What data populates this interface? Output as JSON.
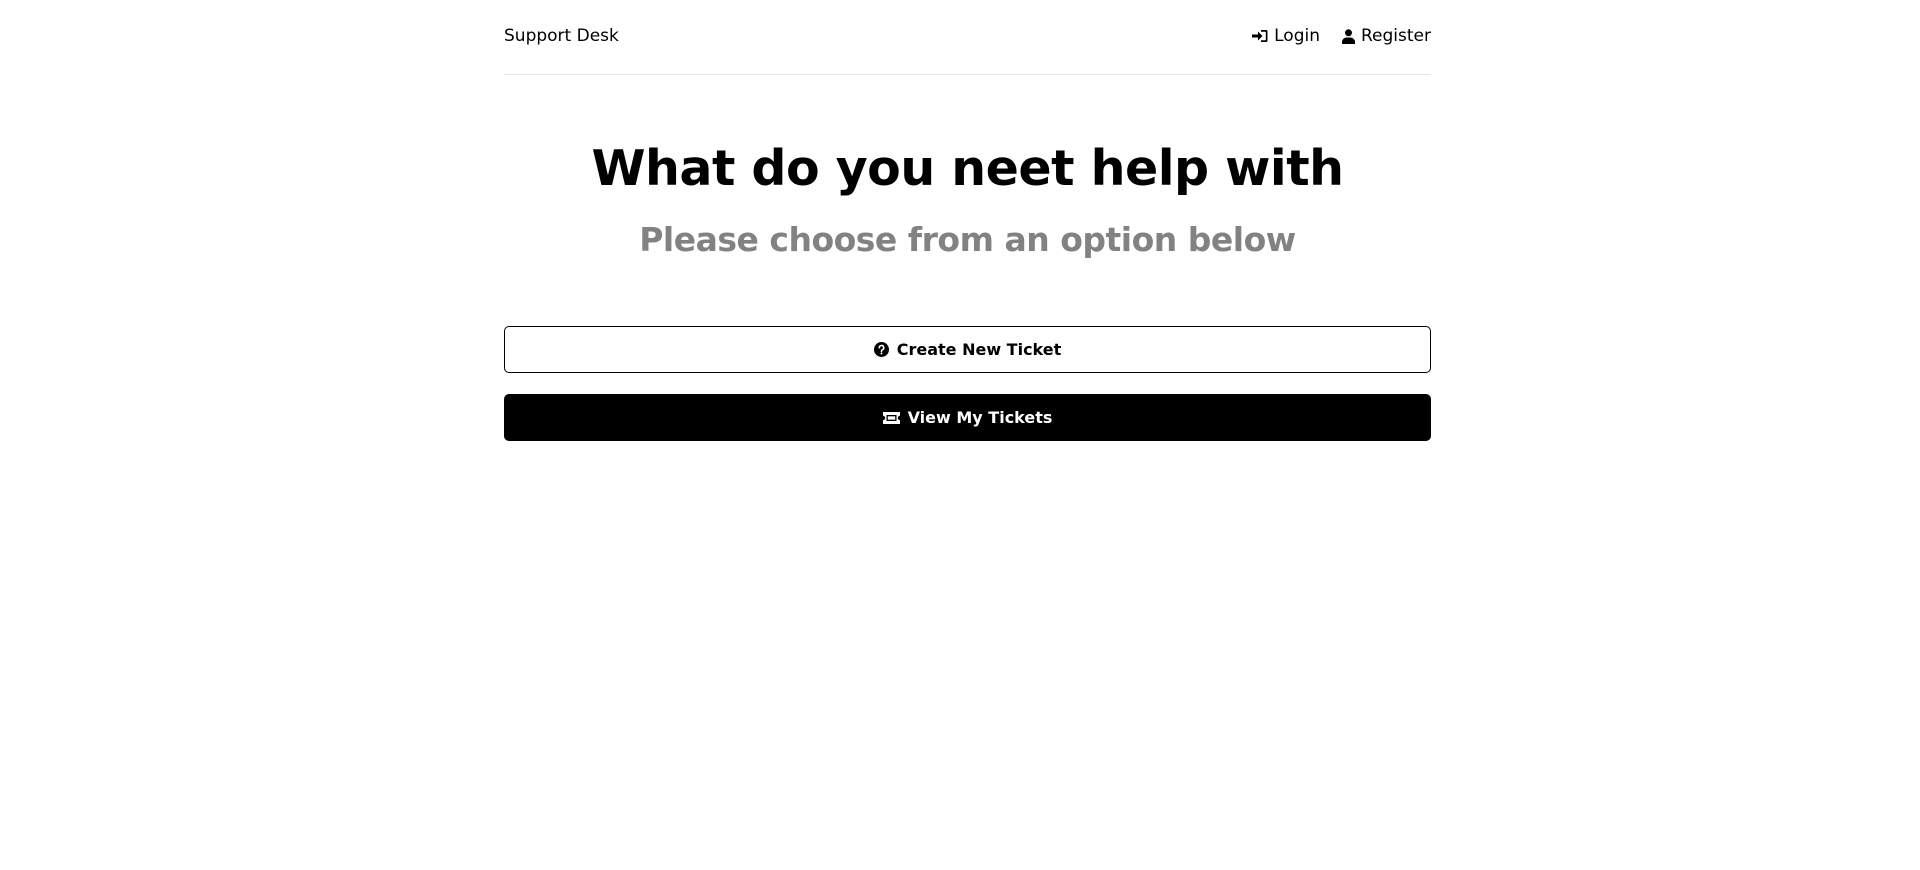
{
  "header": {
    "brand": "Support Desk",
    "nav": {
      "login_label": "Login",
      "login_icon": "sign-in-icon",
      "register_label": "Register",
      "register_icon": "user-icon"
    }
  },
  "hero": {
    "title": "What do you neet help with",
    "subtitle": "Please choose from an option below"
  },
  "actions": {
    "create_ticket_label": "Create New Ticket",
    "create_ticket_icon": "question-circle-icon",
    "view_tickets_label": "View My Tickets",
    "view_tickets_icon": "ticket-icon"
  },
  "colors": {
    "primary": "#000000",
    "subtitle": "#828282",
    "divider": "#e6e6e6",
    "background": "#ffffff"
  }
}
